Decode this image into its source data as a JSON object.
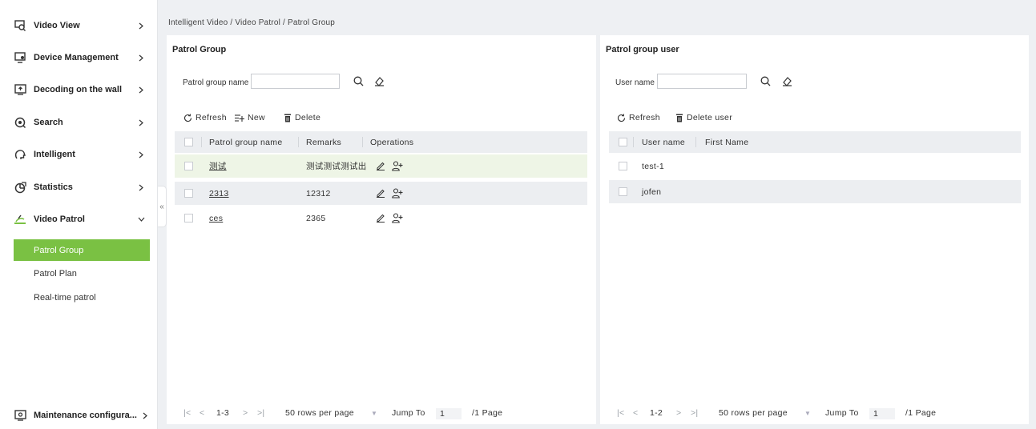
{
  "sidebar": {
    "menu": [
      {
        "label": "Video View",
        "icon": "video-view-icon"
      },
      {
        "label": "Device Management",
        "icon": "device-management-icon"
      },
      {
        "label": "Decoding on the wall",
        "icon": "decoding-wall-icon"
      },
      {
        "label": "Search",
        "icon": "search-menu-icon"
      },
      {
        "label": "Intelligent",
        "icon": "intelligent-icon"
      },
      {
        "label": "Statistics",
        "icon": "statistics-icon"
      },
      {
        "label": "Video Patrol",
        "icon": "video-patrol-icon"
      }
    ],
    "submenu": [
      "Patrol Group",
      "Patrol Plan",
      "Real-time patrol"
    ],
    "bottom_item": {
      "label": "Maintenance configura...",
      "icon": "maintenance-icon"
    },
    "collapse_glyph": "«",
    "accent_color": "#7ac143"
  },
  "breadcrumb": "Intelligent Video / Video Patrol / Patrol Group",
  "left_panel": {
    "title": "Patrol Group",
    "filter_label": "Patrol group name",
    "filter_value": "",
    "toolbar": {
      "refresh": "Refresh",
      "new": "New",
      "delete": "Delete"
    },
    "columns": [
      "Patrol group name",
      "Remarks",
      "Operations"
    ],
    "rows": [
      {
        "name": "测试",
        "remarks": "测试测试测试出"
      },
      {
        "name": "2313",
        "remarks": "12312"
      },
      {
        "name": "ces",
        "remarks": "2365"
      }
    ],
    "pager": {
      "first": "|<",
      "prev": "<",
      "range": "1-3",
      "next": ">",
      "last": ">|",
      "per_page": "50 rows per page",
      "caret": "▼",
      "jump_label": "Jump To",
      "page_value": "1",
      "page_total": "/1 Page"
    }
  },
  "right_panel": {
    "title": "Patrol group user",
    "filter_label": "User name",
    "filter_value": "",
    "toolbar": {
      "refresh": "Refresh",
      "delete_user": "Delete user"
    },
    "columns": [
      "User name",
      "First Name"
    ],
    "rows": [
      {
        "user": "test-1",
        "first": ""
      },
      {
        "user": "jofen",
        "first": ""
      }
    ],
    "pager": {
      "first": "|<",
      "prev": "<",
      "range": "1-2",
      "next": ">",
      "last": ">|",
      "per_page": "50 rows per page",
      "caret": "▼",
      "jump_label": "Jump To",
      "page_value": "1",
      "page_total": "/1 Page"
    }
  }
}
